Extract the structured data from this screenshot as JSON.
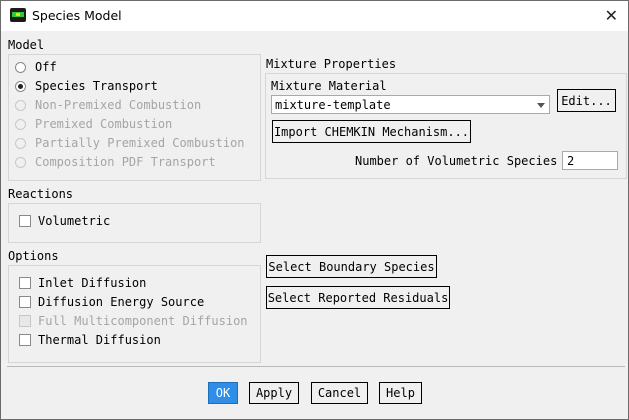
{
  "window": {
    "title": "Species Model",
    "close_glyph": "✕"
  },
  "model": {
    "section_label": "Model",
    "options": [
      {
        "label": "Off",
        "selected": false,
        "enabled": true
      },
      {
        "label": "Species Transport",
        "selected": true,
        "enabled": true
      },
      {
        "label": "Non-Premixed Combustion",
        "selected": false,
        "enabled": false
      },
      {
        "label": "Premixed Combustion",
        "selected": false,
        "enabled": false
      },
      {
        "label": "Partially Premixed Combustion",
        "selected": false,
        "enabled": false
      },
      {
        "label": "Composition PDF Transport",
        "selected": false,
        "enabled": false
      }
    ]
  },
  "mixture": {
    "section_label": "Mixture Properties",
    "material_label": "Mixture Material",
    "material_value": "mixture-template",
    "edit_label": "Edit...",
    "import_label": "Import CHEMKIN Mechanism...",
    "volumetric_species_label": "Number of Volumetric Species",
    "volumetric_species_value": "2"
  },
  "reactions": {
    "section_label": "Reactions",
    "volumetric": {
      "label": "Volumetric",
      "checked": false,
      "enabled": true
    }
  },
  "options": {
    "section_label": "Options",
    "items": [
      {
        "label": "Inlet Diffusion",
        "checked": false,
        "enabled": true
      },
      {
        "label": "Diffusion Energy Source",
        "checked": false,
        "enabled": true
      },
      {
        "label": "Full Multicomponent Diffusion",
        "checked": false,
        "enabled": false
      },
      {
        "label": "Thermal Diffusion",
        "checked": false,
        "enabled": true
      }
    ]
  },
  "actions": {
    "select_boundary_species": "Select Boundary Species",
    "select_reported_residuals": "Select Reported Residuals"
  },
  "footer": {
    "ok": "OK",
    "apply": "Apply",
    "cancel": "Cancel",
    "help": "Help"
  },
  "colors": {
    "primary_button": "#2e8ee8",
    "disabled_text": "#a5a5a5",
    "background": "#f0f0f0"
  },
  "icons": {
    "app": "fluent-app-icon",
    "close": "close-icon"
  }
}
